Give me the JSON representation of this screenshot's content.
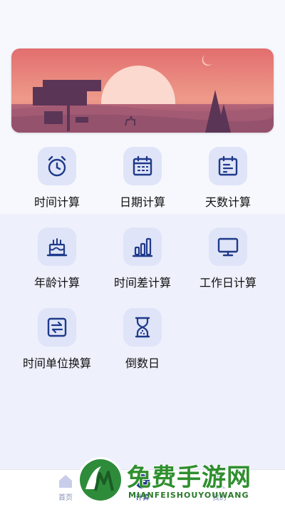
{
  "banner": {
    "illustration": "sunset-landscape"
  },
  "tools": [
    {
      "label": "时间计算",
      "icon": "alarm-clock-icon"
    },
    {
      "label": "日期计算",
      "icon": "calendar-icon"
    },
    {
      "label": "天数计算",
      "icon": "calendar-days-icon"
    },
    {
      "label": "年龄计算",
      "icon": "birthday-cake-icon"
    },
    {
      "label": "时间差计算",
      "icon": "bar-chart-icon"
    },
    {
      "label": "工作日计算",
      "icon": "monitor-icon"
    },
    {
      "label": "时间单位换算",
      "icon": "swap-icon"
    },
    {
      "label": "倒数日",
      "icon": "hourglass-icon"
    }
  ],
  "nav": [
    {
      "label": "首页",
      "icon": "home-icon"
    },
    {
      "label": "计算",
      "icon": "calculator-icon"
    },
    {
      "label": "我的",
      "icon": "profile-icon"
    }
  ],
  "watermark": {
    "title": "免费手游网",
    "subtitle": "MIANFEISHOUYOUWANG"
  },
  "colors": {
    "accent": "#1f3a8a",
    "icon_bg": "#dfe4f8",
    "page_bg": "#eef0fb"
  }
}
